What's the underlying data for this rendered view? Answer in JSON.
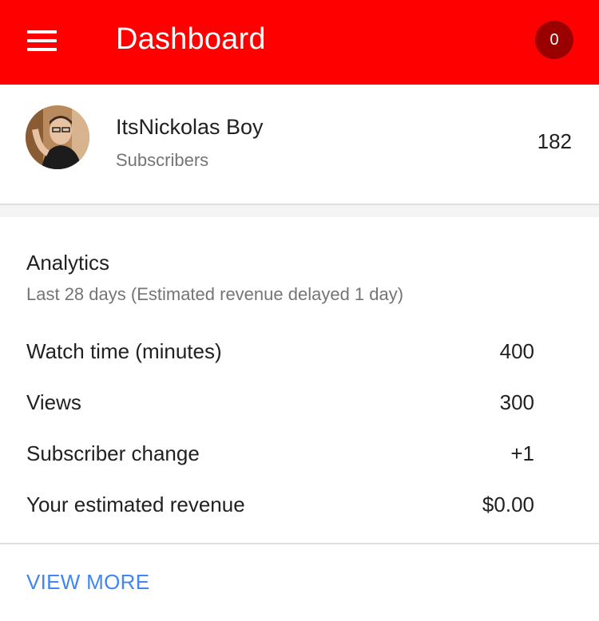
{
  "header": {
    "title": "Dashboard",
    "notification_count": "0",
    "menu_icon": "hamburger-menu-icon",
    "brand_color": "#ff0000"
  },
  "channel": {
    "name": "ItsNickolas Boy",
    "subscribers_label": "Subscribers",
    "subscriber_count": "182"
  },
  "analytics": {
    "title": "Analytics",
    "subtitle": "Last 28 days (Estimated revenue delayed 1 day)",
    "metrics": [
      {
        "label": "Watch time (minutes)",
        "value": "400"
      },
      {
        "label": "Views",
        "value": "300"
      },
      {
        "label": "Subscriber change",
        "value": "+1"
      },
      {
        "label": "Your estimated revenue",
        "value": "$0.00"
      }
    ]
  },
  "actions": {
    "view_more_label": "VIEW MORE",
    "link_color": "#4285f4"
  }
}
